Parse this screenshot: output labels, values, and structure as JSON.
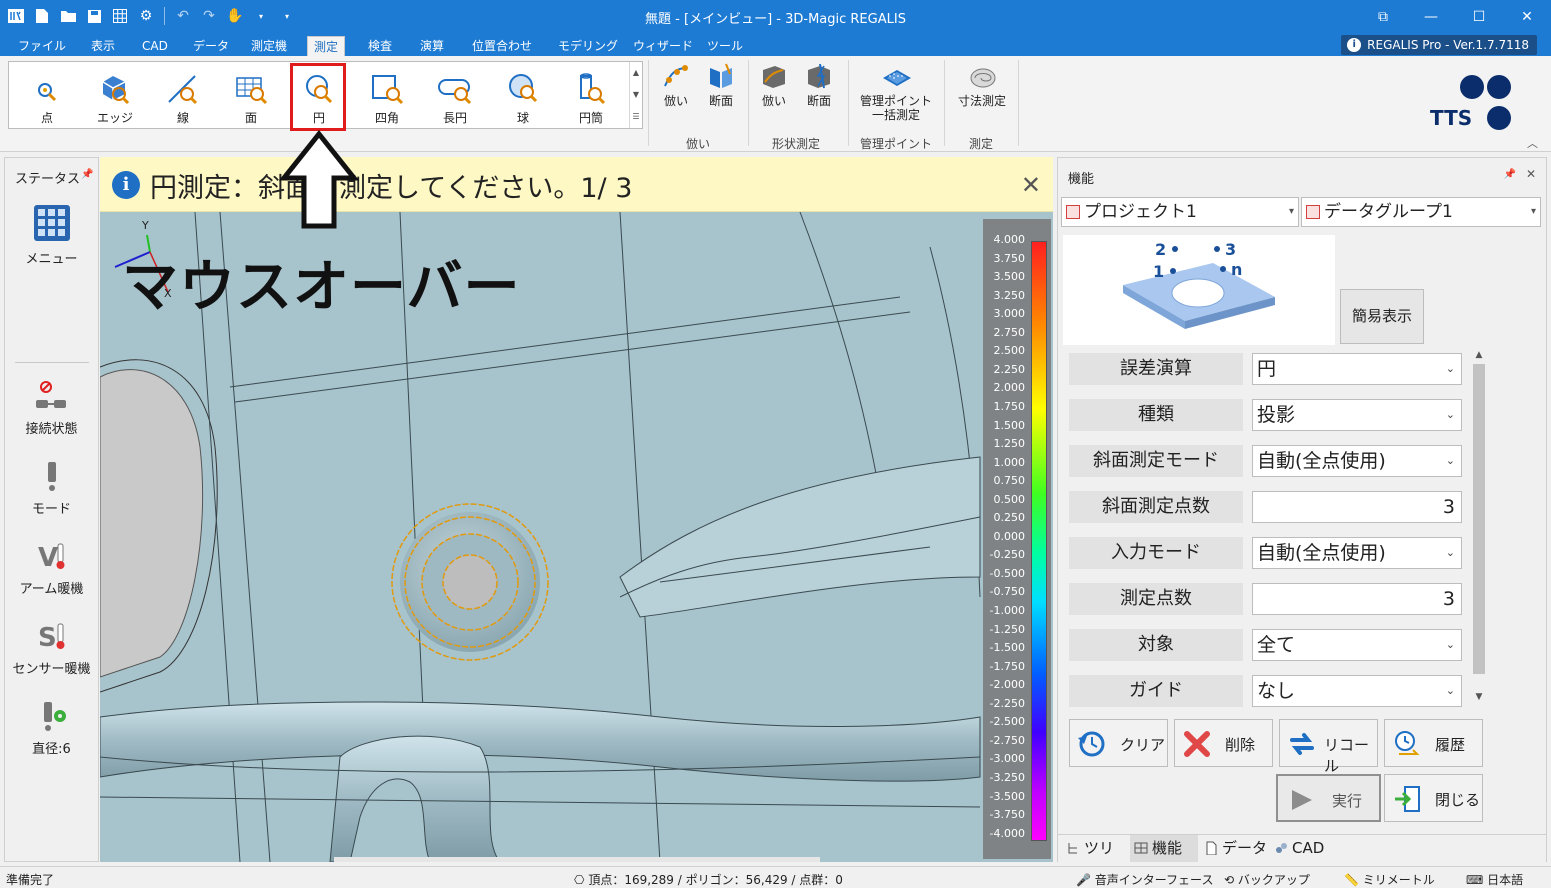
{
  "window": {
    "title": "無題 - [メインビュー] - 3D-Magic REGALIS",
    "version_badge": "REGALIS Pro - Ver.1.7.7118"
  },
  "menu_tabs": [
    {
      "label": "ファイル",
      "active": false
    },
    {
      "label": "表示",
      "active": false
    },
    {
      "label": "CAD",
      "active": false
    },
    {
      "label": "データ",
      "active": false
    },
    {
      "label": "測定機",
      "active": false
    },
    {
      "label": "測定",
      "active": true
    },
    {
      "label": "検査",
      "active": false
    },
    {
      "label": "演算",
      "active": false
    },
    {
      "label": "位置合わせ",
      "active": false
    },
    {
      "label": "モデリング",
      "active": false
    },
    {
      "label": "ウィザード",
      "active": false
    },
    {
      "label": "ツール",
      "active": false
    }
  ],
  "ribbon": {
    "gallery": [
      "点",
      "エッジ",
      "線",
      "面",
      "円",
      "四角",
      "長円",
      "球",
      "円筒"
    ],
    "groups": {
      "narai": {
        "label": "倣い",
        "buttons": [
          "倣い",
          "断面"
        ]
      },
      "shape": {
        "label": "形状測定",
        "buttons": [
          "倣い",
          "断面"
        ]
      },
      "mgmt": {
        "label": "管理ポイント",
        "button": "管理ポイント一括測定",
        "line1": "管理ポイント",
        "line2": "一括測定"
      },
      "measure": {
        "label": "測定",
        "button": "寸法測定"
      }
    },
    "logo": "TTS"
  },
  "left_panel": {
    "title": "ステータス",
    "items": [
      "メニュー",
      "接続状態",
      "モード",
      "アーム暖機",
      "センサー暖機",
      "直径:6"
    ]
  },
  "viewport": {
    "info_message": "円測定：斜面を測定してください。1/ 3",
    "overlay_text": "マウスオーバー",
    "axis_y": "Y",
    "axis_x": "X",
    "scale_values": [
      "4.000",
      "3.750",
      "3.500",
      "3.250",
      "3.000",
      "2.750",
      "2.500",
      "2.250",
      "2.000",
      "1.750",
      "1.500",
      "1.250",
      "1.000",
      "0.750",
      "0.500",
      "0.250",
      "0.000",
      "-0.250",
      "-0.500",
      "-0.750",
      "-1.000",
      "-1.250",
      "-1.500",
      "-1.750",
      "-2.000",
      "-2.250",
      "-2.500",
      "-2.750",
      "-3.000",
      "-3.250",
      "-3.500",
      "-3.750",
      "-4.000"
    ]
  },
  "right_panel": {
    "title": "機能",
    "project": "プロジェクト1",
    "datagroup": "データグループ1",
    "preview_labels": {
      "p1": "1",
      "p2": "2",
      "p3": "3",
      "pn": "n"
    },
    "simple_view": "簡易表示",
    "properties": [
      {
        "label": "誤差演算",
        "value": "円",
        "kind": "select"
      },
      {
        "label": "種類",
        "value": "投影",
        "kind": "select"
      },
      {
        "label": "斜面測定モード",
        "value": "自動(全点使用)",
        "kind": "select"
      },
      {
        "label": "斜面測定点数",
        "value": "3",
        "kind": "number"
      },
      {
        "label": "入力モード",
        "value": "自動(全点使用)",
        "kind": "select"
      },
      {
        "label": "測定点数",
        "value": "3",
        "kind": "number"
      },
      {
        "label": "対象",
        "value": "全て",
        "kind": "select"
      },
      {
        "label": "ガイド",
        "value": "なし",
        "kind": "select"
      }
    ],
    "buttons": {
      "clear": "クリア",
      "delete": "削除",
      "recall": "リコール",
      "history": "履歴",
      "execute": "実行",
      "close": "閉じる"
    },
    "bottom_tabs": [
      "ツリー",
      "機能",
      "データ",
      "CAD"
    ]
  },
  "status_bar": {
    "left": "準備完了",
    "stats": "頂点：169,289 / ポリゴン：56,429 / 点群：0",
    "voice": "音声インターフェース",
    "backup": "バックアップ",
    "unit": "ミリメートル",
    "language": "日本語"
  },
  "colors": {
    "title_blue": "#1e7bd4",
    "highlight_red": "#e01b1b",
    "info_yellow": "#fdf8c4",
    "viewport_bg": "#a7c3cc"
  }
}
